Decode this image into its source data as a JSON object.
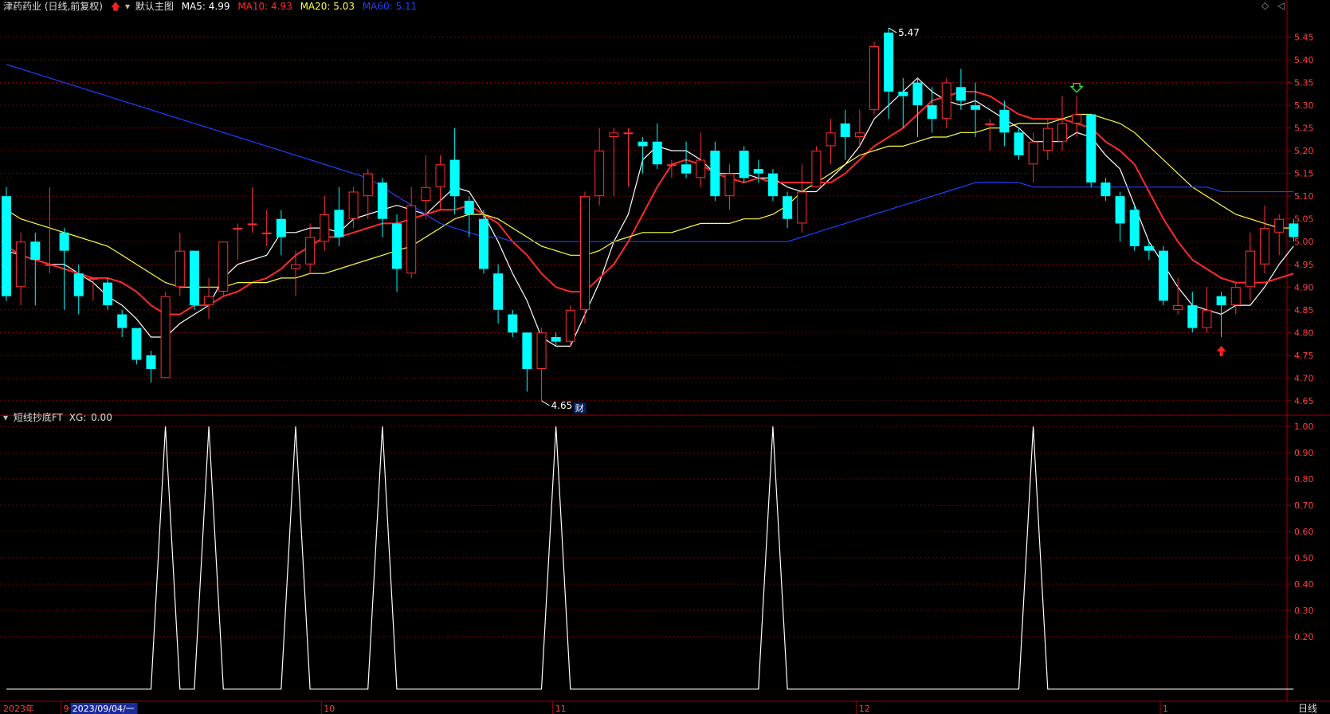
{
  "header": {
    "title": "津药药业 (日线,前复权)",
    "main_template": "默认主图",
    "ma5": {
      "label": "MA5:",
      "value": "4.99",
      "color": "#ffffff"
    },
    "ma10": {
      "label": "MA10:",
      "value": "4.93",
      "color": "#ff2a2a"
    },
    "ma20": {
      "label": "MA20:",
      "value": "5.03",
      "color": "#ffff40"
    },
    "ma60": {
      "label": "MA60:",
      "value": "5.11",
      "color": "#2040ff"
    }
  },
  "sub_header": {
    "indicator": "短线抄底FT",
    "xg_label": "XG:",
    "xg_value": "0.00"
  },
  "markers": {
    "high_label": "5.47",
    "low_label": "4.65",
    "finance_badge": "财"
  },
  "bottom_axis": {
    "year_label": "2023年",
    "selected_date": "2023/09/04/一",
    "months": [
      "9",
      "10",
      "11",
      "12",
      "1"
    ],
    "period": "日线"
  },
  "colors": {
    "up": "#ff3030",
    "down": "#00ffff",
    "grid": "#7a0000",
    "border": "#a00000",
    "axis_text": "#ff4040"
  },
  "chart_data": [
    {
      "type": "candlestick",
      "y_ticks": [
        "5.45",
        "5.40",
        "5.35",
        "5.30",
        "5.25",
        "5.20",
        "5.15",
        "5.10",
        "5.05",
        "5.00",
        "4.95",
        "4.90",
        "4.85",
        "4.80",
        "4.75",
        "4.70",
        "4.65"
      ],
      "ylim": [
        4.62,
        5.5
      ],
      "candles": [
        [
          5.1,
          4.88,
          5.12,
          4.87
        ],
        [
          4.9,
          5.0,
          5.02,
          4.86
        ],
        [
          5.0,
          4.96,
          5.02,
          4.86
        ],
        [
          4.95,
          4.95,
          5.12,
          4.93
        ],
        [
          5.02,
          4.98,
          5.03,
          4.85
        ],
        [
          4.93,
          4.88,
          4.95,
          4.84
        ],
        [
          4.92,
          4.92,
          4.92,
          4.87
        ],
        [
          4.91,
          4.86,
          4.92,
          4.85
        ],
        [
          4.84,
          4.81,
          4.85,
          4.79
        ],
        [
          4.81,
          4.74,
          4.81,
          4.73
        ],
        [
          4.75,
          4.72,
          4.76,
          4.69
        ],
        [
          4.7,
          4.88,
          4.89,
          4.7
        ],
        [
          4.9,
          4.98,
          5.02,
          4.88
        ],
        [
          4.98,
          4.86,
          4.98,
          4.85
        ],
        [
          4.86,
          4.88,
          4.92,
          4.83
        ],
        [
          4.89,
          5.0,
          5.0,
          4.88
        ],
        [
          5.03,
          5.03,
          5.04,
          4.96
        ],
        [
          5.04,
          5.04,
          5.12,
          5.02
        ],
        [
          5.02,
          5.02,
          5.07,
          4.99
        ],
        [
          5.05,
          5.01,
          5.07,
          4.97
        ],
        [
          4.94,
          4.95,
          4.98,
          4.88
        ],
        [
          4.95,
          5.01,
          5.04,
          4.93
        ],
        [
          5.0,
          5.06,
          5.1,
          4.98
        ],
        [
          5.07,
          5.01,
          5.12,
          4.99
        ],
        [
          5.05,
          5.11,
          5.12,
          5.03
        ],
        [
          5.1,
          5.15,
          5.16,
          5.05
        ],
        [
          5.13,
          5.05,
          5.14,
          5.01
        ],
        [
          5.04,
          4.94,
          5.06,
          4.89
        ],
        [
          4.93,
          5.08,
          5.12,
          4.92
        ],
        [
          5.09,
          5.12,
          5.19,
          5.05
        ],
        [
          5.12,
          5.17,
          5.19,
          5.07
        ],
        [
          5.18,
          5.1,
          5.25,
          5.06
        ],
        [
          5.09,
          5.06,
          5.1,
          5.01
        ],
        [
          5.05,
          4.94,
          5.07,
          4.93
        ],
        [
          4.93,
          4.85,
          4.95,
          4.82
        ],
        [
          4.84,
          4.8,
          4.85,
          4.79
        ],
        [
          4.8,
          4.72,
          4.8,
          4.67
        ],
        [
          4.72,
          4.8,
          4.81,
          4.65
        ],
        [
          4.79,
          4.78,
          4.8,
          4.77
        ],
        [
          4.78,
          4.85,
          4.86,
          4.77
        ],
        [
          4.85,
          5.1,
          5.11,
          4.82
        ],
        [
          5.1,
          5.2,
          5.25,
          5.08
        ],
        [
          5.23,
          5.24,
          5.25,
          5.1
        ],
        [
          5.24,
          5.24,
          5.25,
          5.12
        ],
        [
          5.22,
          5.21,
          5.23,
          5.15
        ],
        [
          5.22,
          5.17,
          5.26,
          5.16
        ],
        [
          5.17,
          5.17,
          5.18,
          5.14
        ],
        [
          5.17,
          5.15,
          5.22,
          5.14
        ],
        [
          5.14,
          5.18,
          5.24,
          5.12
        ],
        [
          5.2,
          5.1,
          5.22,
          5.09
        ],
        [
          5.1,
          5.15,
          5.17,
          5.07
        ],
        [
          5.2,
          5.14,
          5.21,
          5.13
        ],
        [
          5.16,
          5.15,
          5.18,
          5.13
        ],
        [
          5.15,
          5.1,
          5.16,
          5.09
        ],
        [
          5.1,
          5.05,
          5.11,
          5.03
        ],
        [
          5.04,
          5.11,
          5.17,
          5.02
        ],
        [
          5.12,
          5.2,
          5.21,
          5.12
        ],
        [
          5.21,
          5.24,
          5.27,
          5.17
        ],
        [
          5.26,
          5.23,
          5.29,
          5.18
        ],
        [
          5.23,
          5.24,
          5.29,
          5.21
        ],
        [
          5.29,
          5.43,
          5.44,
          5.28
        ],
        [
          5.46,
          5.33,
          5.47,
          5.27
        ],
        [
          5.33,
          5.32,
          5.36,
          5.25
        ],
        [
          5.35,
          5.3,
          5.36,
          5.23
        ],
        [
          5.3,
          5.27,
          5.34,
          5.24
        ],
        [
          5.27,
          5.35,
          5.36,
          5.25
        ],
        [
          5.34,
          5.31,
          5.38,
          5.29
        ],
        [
          5.3,
          5.29,
          5.35,
          5.23
        ],
        [
          5.26,
          5.26,
          5.27,
          5.2
        ],
        [
          5.29,
          5.24,
          5.31,
          5.21
        ],
        [
          5.24,
          5.19,
          5.25,
          5.18
        ],
        [
          5.17,
          5.22,
          5.24,
          5.13
        ],
        [
          5.2,
          5.25,
          5.27,
          5.18
        ],
        [
          5.22,
          5.26,
          5.32,
          5.2
        ],
        [
          5.26,
          5.28,
          5.32,
          5.23
        ],
        [
          5.28,
          5.13,
          5.28,
          5.12
        ],
        [
          5.13,
          5.1,
          5.14,
          5.09
        ],
        [
          5.1,
          5.04,
          5.11,
          5.0
        ],
        [
          5.07,
          4.99,
          5.08,
          4.98
        ],
        [
          4.99,
          4.98,
          5.0,
          4.96
        ],
        [
          4.98,
          4.87,
          4.99,
          4.86
        ],
        [
          4.85,
          4.86,
          4.92,
          4.84
        ],
        [
          4.86,
          4.81,
          4.89,
          4.8
        ],
        [
          4.81,
          4.85,
          4.9,
          4.8
        ],
        [
          4.88,
          4.86,
          4.89,
          4.79
        ],
        [
          4.86,
          4.9,
          4.91,
          4.84
        ],
        [
          4.9,
          4.98,
          5.02,
          4.87
        ],
        [
          4.95,
          5.03,
          5.08,
          4.93
        ],
        [
          5.02,
          5.05,
          5.06,
          4.97
        ],
        [
          5.04,
          5.01,
          5.05,
          5.0
        ]
      ],
      "series": [
        {
          "name": "MA5",
          "color": "#ffffff",
          "values": [
            4.98,
            4.97,
            4.96,
            4.95,
            4.95,
            4.93,
            4.91,
            4.88,
            4.86,
            4.83,
            4.79,
            4.79,
            4.82,
            4.84,
            4.86,
            4.92,
            4.95,
            4.96,
            4.97,
            5.02,
            5.02,
            5.03,
            5.03,
            5.02,
            5.05,
            5.06,
            5.07,
            5.08,
            5.07,
            5.06,
            5.09,
            5.12,
            5.11,
            5.06,
            5.0,
            4.93,
            4.87,
            4.79,
            4.77,
            4.77,
            4.84,
            4.91,
            5.0,
            5.06,
            5.18,
            5.21,
            5.2,
            5.2,
            5.18,
            5.15,
            5.15,
            5.15,
            5.14,
            5.14,
            5.12,
            5.11,
            5.11,
            5.14,
            5.17,
            5.21,
            5.27,
            5.3,
            5.33,
            5.36,
            5.33,
            5.31,
            5.3,
            5.31,
            5.29,
            5.27,
            5.25,
            5.22,
            5.22,
            5.22,
            5.24,
            5.23,
            5.19,
            5.16,
            5.08,
            5.0,
            4.95,
            4.9,
            4.86,
            4.85,
            4.84,
            4.86,
            4.86,
            4.9,
            4.95,
            4.99
          ]
        },
        {
          "name": "MA10",
          "color": "#ff2a2a",
          "values": [
            4.99,
            4.97,
            4.96,
            4.95,
            4.94,
            4.93,
            4.92,
            4.92,
            4.91,
            4.89,
            4.86,
            4.84,
            4.84,
            4.86,
            4.86,
            4.88,
            4.89,
            4.91,
            4.92,
            4.94,
            4.97,
            4.99,
            5.01,
            5.01,
            5.02,
            5.03,
            5.04,
            5.04,
            5.05,
            5.06,
            5.07,
            5.07,
            5.08,
            5.06,
            5.04,
            5.0,
            4.97,
            4.93,
            4.9,
            4.89,
            4.89,
            4.92,
            4.95,
            5.0,
            5.06,
            5.12,
            5.17,
            5.18,
            5.17,
            5.15,
            5.14,
            5.13,
            5.14,
            5.13,
            5.13,
            5.13,
            5.13,
            5.13,
            5.15,
            5.18,
            5.21,
            5.23,
            5.25,
            5.28,
            5.31,
            5.32,
            5.33,
            5.33,
            5.32,
            5.3,
            5.28,
            5.27,
            5.27,
            5.27,
            5.26,
            5.25,
            5.22,
            5.2,
            5.17,
            5.11,
            5.05,
            5.0,
            4.96,
            4.94,
            4.92,
            4.91,
            4.91,
            4.91,
            4.92,
            4.93
          ]
        },
        {
          "name": "MA20",
          "color": "#ffff40",
          "values": [
            5.07,
            5.05,
            5.04,
            5.03,
            5.02,
            5.01,
            5.0,
            4.99,
            4.97,
            4.95,
            4.93,
            4.91,
            4.9,
            4.9,
            4.9,
            4.9,
            4.91,
            4.91,
            4.91,
            4.92,
            4.92,
            4.93,
            4.93,
            4.94,
            4.95,
            4.96,
            4.97,
            4.98,
            4.99,
            5.01,
            5.03,
            5.05,
            5.06,
            5.06,
            5.05,
            5.03,
            5.01,
            4.99,
            4.98,
            4.97,
            4.97,
            4.98,
            5.0,
            5.01,
            5.02,
            5.02,
            5.02,
            5.03,
            5.04,
            5.04,
            5.04,
            5.05,
            5.05,
            5.06,
            5.08,
            5.11,
            5.13,
            5.15,
            5.17,
            5.19,
            5.2,
            5.21,
            5.21,
            5.22,
            5.23,
            5.23,
            5.24,
            5.24,
            5.25,
            5.25,
            5.26,
            5.26,
            5.26,
            5.27,
            5.28,
            5.28,
            5.27,
            5.26,
            5.24,
            5.21,
            5.18,
            5.15,
            5.12,
            5.1,
            5.08,
            5.06,
            5.05,
            5.04,
            5.03,
            5.03
          ]
        },
        {
          "name": "MA60",
          "color": "#2040ff",
          "values": [
            5.39,
            5.38,
            5.37,
            5.36,
            5.35,
            5.34,
            5.33,
            5.32,
            5.31,
            5.3,
            5.29,
            5.28,
            5.27,
            5.26,
            5.25,
            5.24,
            5.23,
            5.22,
            5.21,
            5.2,
            5.19,
            5.18,
            5.17,
            5.16,
            5.15,
            5.14,
            5.12,
            5.1,
            5.08,
            5.06,
            5.04,
            5.03,
            5.02,
            5.01,
            5.01,
            5.0,
            5.0,
            5.0,
            5.0,
            5.0,
            5.0,
            5.0,
            5.0,
            5.0,
            5.0,
            5.0,
            5.0,
            5.0,
            5.0,
            5.0,
            5.0,
            5.0,
            5.0,
            5.0,
            5.0,
            5.01,
            5.02,
            5.03,
            5.04,
            5.05,
            5.06,
            5.07,
            5.08,
            5.09,
            5.1,
            5.11,
            5.12,
            5.13,
            5.13,
            5.13,
            5.13,
            5.12,
            5.12,
            5.12,
            5.12,
            5.12,
            5.12,
            5.12,
            5.12,
            5.12,
            5.12,
            5.12,
            5.12,
            5.12,
            5.11,
            5.11,
            5.11,
            5.11,
            5.11,
            5.11
          ]
        }
      ]
    },
    {
      "type": "line",
      "title": "短线抄底FT",
      "y_ticks": [
        "1.00",
        "0.90",
        "0.80",
        "0.70",
        "0.60",
        "0.50",
        "0.40",
        "0.30",
        "0.20"
      ],
      "ylim": [
        -0.04,
        1.04
      ],
      "series": [
        {
          "name": "XG",
          "color": "#ffffff",
          "signal_indices": [
            11,
            14,
            20,
            26,
            38,
            53,
            71
          ]
        }
      ]
    }
  ]
}
